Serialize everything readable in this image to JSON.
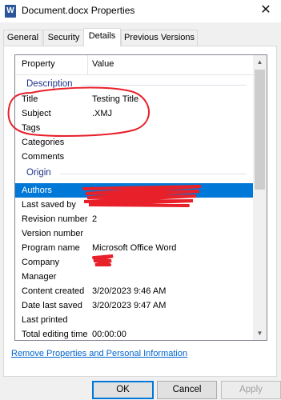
{
  "window": {
    "title": "Document.docx Properties",
    "app_icon_letter": "W",
    "close_glyph": "✕"
  },
  "tabs": [
    {
      "label": "General"
    },
    {
      "label": "Security"
    },
    {
      "label": "Details"
    },
    {
      "label": "Previous Versions"
    }
  ],
  "active_tab": "Details",
  "details": {
    "column_property": "Property",
    "column_value": "Value",
    "groups": [
      {
        "label": "Description"
      },
      {
        "label": "Origin"
      }
    ],
    "description_rows": [
      {
        "prop": "Title",
        "value": "Testing Title"
      },
      {
        "prop": "Subject",
        "value": ".XMJ"
      },
      {
        "prop": "Tags",
        "value": ""
      },
      {
        "prop": "Categories",
        "value": ""
      },
      {
        "prop": "Comments",
        "value": ""
      }
    ],
    "origin_rows": [
      {
        "prop": "Authors",
        "value": ""
      },
      {
        "prop": "Last saved by",
        "value": ""
      },
      {
        "prop": "Revision number",
        "value": "2"
      },
      {
        "prop": "Version number",
        "value": ""
      },
      {
        "prop": "Program name",
        "value": "Microsoft Office Word"
      },
      {
        "prop": "Company",
        "value": ""
      },
      {
        "prop": "Manager",
        "value": ""
      },
      {
        "prop": "Content created",
        "value": "3/20/2023 9:46 AM"
      },
      {
        "prop": "Date last saved",
        "value": "3/20/2023 9:47 AM"
      },
      {
        "prop": "Last printed",
        "value": ""
      },
      {
        "prop": "Total editing time",
        "value": "00:00:00"
      }
    ]
  },
  "scrollbar": {
    "up_glyph": "▲",
    "down_glyph": "▼"
  },
  "link_text": "Remove Properties and Personal Information",
  "buttons": {
    "ok": "OK",
    "cancel": "Cancel",
    "apply": "Apply"
  },
  "colors": {
    "selection": "#0078d7",
    "annotation_red": "#e8202a",
    "link": "#0066cc",
    "group_label": "#1e3287"
  }
}
